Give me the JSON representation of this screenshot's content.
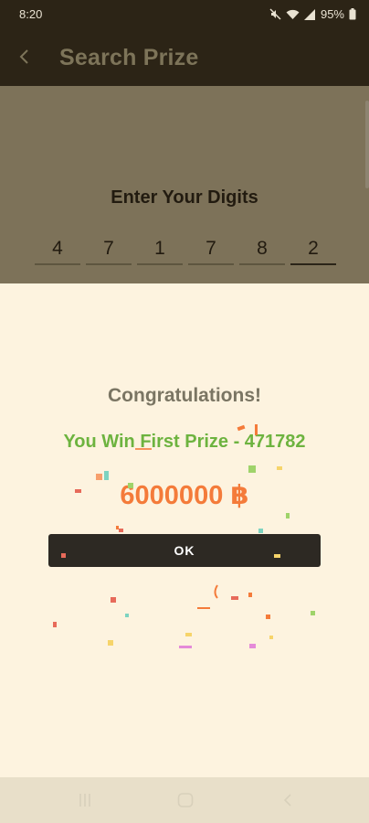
{
  "status_bar": {
    "time": "8:20",
    "battery": "95%"
  },
  "app_bar": {
    "title": "Search Prize"
  },
  "search": {
    "label": "Enter Your Digits",
    "digits": [
      "4",
      "7",
      "1",
      "7",
      "8",
      "2"
    ]
  },
  "dialog": {
    "title": "Congratulations!",
    "result": "You Win First Prize - 471782",
    "amount": "6000000 ฿",
    "ok_label": "OK"
  },
  "colors": {
    "app_bar_bg": "#2c2416",
    "overlay_bg": "#7d7259",
    "dialog_bg": "#fdf3df",
    "win_text": "#6db33f",
    "amount_text": "#f47b3a",
    "ok_button_bg": "#2d2923"
  },
  "icons": [
    "mute-icon",
    "wifi-icon",
    "signal-icon",
    "battery-icon",
    "back-arrow-icon",
    "recents-icon",
    "home-icon",
    "nav-back-icon"
  ]
}
